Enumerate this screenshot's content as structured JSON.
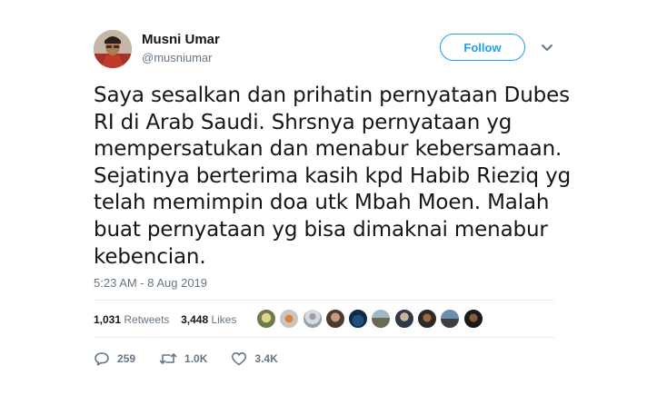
{
  "header": {
    "display_name": "Musni Umar",
    "handle": "@musniumar",
    "follow_label": "Follow"
  },
  "tweet": {
    "lines": [
      "Saya sesalkan dan prihatin pernyataan Dubes",
      "RI di Arab Saudi. Shrsnya pernyataan yg",
      "mempersatukan dan menabur kebersamaan.",
      "Sejatinya berterima kasih kpd Habib Rieziq yg",
      "telah memimpin doa utk Mbah Moen. Malah",
      "buat pernyataan yg bisa dimaknai menabur",
      "kebencian."
    ],
    "timestamp": "5:23 AM - 8 Aug 2019"
  },
  "stats": {
    "retweets_count": "1,031",
    "retweets_label": "Retweets",
    "likes_count": "3,448",
    "likes_label": "Likes"
  },
  "liker_avatars": [
    "avatar",
    "avatar",
    "avatar",
    "avatar",
    "avatar",
    "avatar",
    "avatar",
    "avatar",
    "avatar",
    "avatar"
  ],
  "actions": {
    "reply_count": "259",
    "retweet_count": "1.0K",
    "like_count": "3.4K"
  },
  "colors": {
    "accent": "#1da1f2",
    "muted": "#657786",
    "text": "#14171a",
    "divider": "#e6ecf0"
  }
}
